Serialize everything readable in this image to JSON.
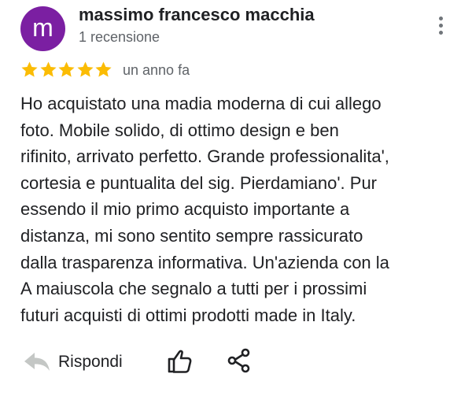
{
  "review": {
    "author_name": "massimo francesco macchia",
    "author_initial": "m",
    "review_count": "1 recensione",
    "rating": 5,
    "rating_max": 5,
    "date": "un anno fa",
    "text": "Ho acquistato una madia moderna di cui allego\nfoto. Mobile solido, di ottimo design e ben\nrifinito, arrivato perfetto. Grande professionalita',\ncortesia e puntualita del sig. Pierdamiano'. Pur\nessendo il mio primo acquisto importante a\ndistanza, mi sono sentito sempre  rassicurato\ndalla trasparenza informativa. Un'azienda  con la\nA maiuscola che segnalo  a tutti per i  prossimi\nfuturi  acquisti di ottimi prodotti made in Italy."
  },
  "actions": {
    "reply_label": "Rispondi",
    "reply_icon": "reply-arrow-icon",
    "like_icon": "thumbs-up-icon",
    "share_icon": "share-icon",
    "more_icon": "more-vertical-icon"
  },
  "colors": {
    "avatar_bg": "#7b1fa2",
    "star": "#fbbc04",
    "reply_icon": "#c4c7c5",
    "icon": "#202124",
    "text_primary": "#202124",
    "text_secondary": "#5f6368"
  }
}
